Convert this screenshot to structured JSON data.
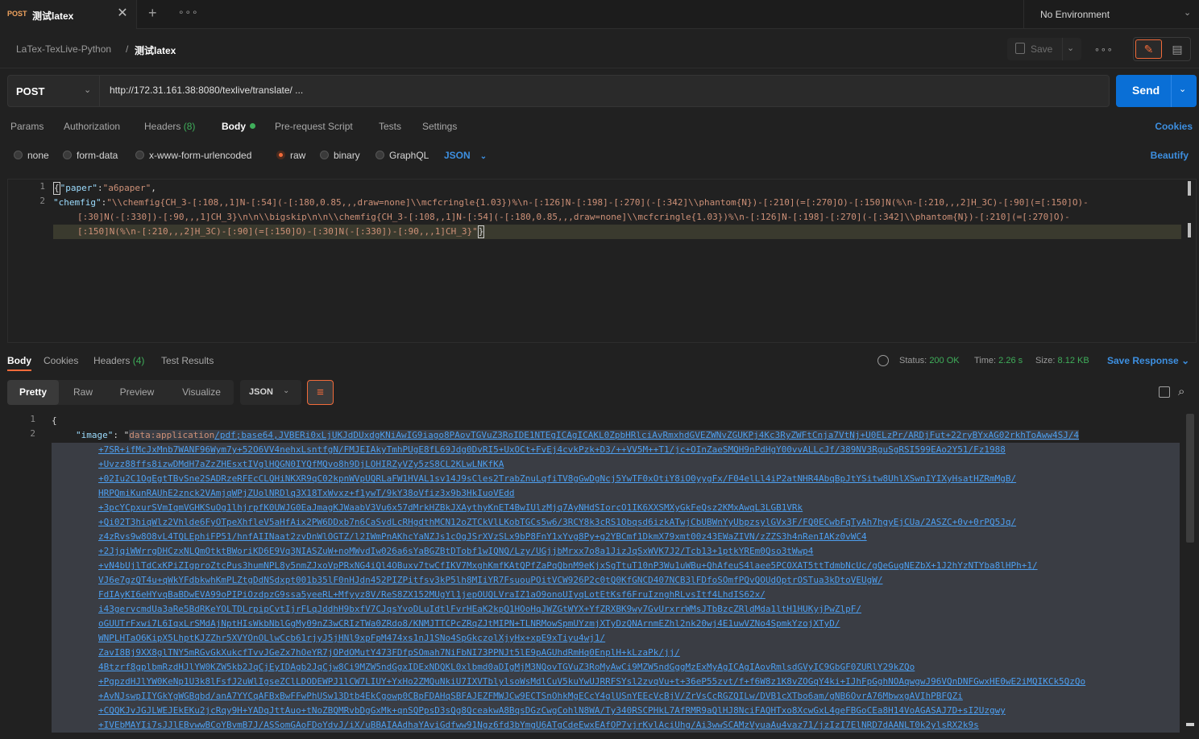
{
  "tab": {
    "method": "POST",
    "name": "测试latex",
    "close": "✕"
  },
  "tabbar": {
    "new_tab": "+",
    "more": "∘∘∘"
  },
  "environment": {
    "label": "No Environment",
    "chevron": "⌄"
  },
  "breadcrumb": {
    "collection": "LaTex-TexLive-Python",
    "separator": "/",
    "request": "测试latex"
  },
  "toolbar": {
    "save_label": "Save",
    "more": "∘∘∘"
  },
  "request": {
    "method": "POST",
    "url": "http://172.31.161.38:8080/texlive/translate/ ...",
    "send_label": "Send"
  },
  "request_tabs": {
    "params": "Params",
    "authorization": "Authorization",
    "headers": "Headers",
    "headers_count": "(8)",
    "body": "Body",
    "pre_request": "Pre-request Script",
    "tests": "Tests",
    "settings": "Settings",
    "cookies": "Cookies"
  },
  "body_types": {
    "none": "none",
    "form_data": "form-data",
    "urlencoded": "x-www-form-urlencoded",
    "raw": "raw",
    "binary": "binary",
    "graphql": "GraphQL",
    "format": "JSON",
    "beautify": "Beautify",
    "selected": "raw"
  },
  "editor": {
    "line_numbers": [
      "1",
      "2"
    ],
    "line1_key": "\"paper\"",
    "line1_value": "\"a6paper\"",
    "line2_key": "\"chemfig\"",
    "line2_part1": "\"\\\\chemfig{CH_3-[:108,,1]N-[:54](-[:180,0.85,,,draw=none]\\\\mcfcringle{1.03})%\\n-[:126]N-[:198]-[:270](-[:342]\\\\phantom{N})-[:210](=[:270]O)-[:150]N(%\\n-[:210,,,2]H_3C)-[:90](=[:150]O)-",
    "line2_part2": "[:30]N(-[:330])-[:90,,,1]CH_3}\\n\\n\\\\bigskip\\n\\n\\\\chemfig{CH_3-[:108,,1]N-[:54](-[:180,0.85,,,draw=none]\\\\mcfcringle{1.03})%\\n-[:126]N-[:198]-[:270](-[:342]\\\\phantom{N})-[:210](=[:270]O)-",
    "line2_part3": "[:150]N(%\\n-[:210,,,2]H_3C)-[:90](=[:150]O)-[:30]N(-[:330])-[:90,,,1]CH_3}\""
  },
  "response_tabs": {
    "body": "Body",
    "cookies": "Cookies",
    "headers": "Headers",
    "headers_count": "(4)",
    "test_results": "Test Results"
  },
  "response_status": {
    "status_label": "Status:",
    "status_value": "200 OK",
    "time_label": "Time:",
    "time_value": "2.26 s",
    "size_label": "Size:",
    "size_value": "8.12 KB",
    "save_response": "Save Response"
  },
  "response_view": {
    "pretty": "Pretty",
    "raw": "Raw",
    "preview": "Preview",
    "visualize": "Visualize",
    "format": "JSON"
  },
  "response_body": {
    "line_numbers": [
      "1",
      "2"
    ],
    "open_brace": "{",
    "key": "\"image\"",
    "colon": ": \"",
    "data_prefix": "data:application",
    "lines": [
      "/pdf;base64,JVBERi0xLjUKJdDUxdgKNiAwIG9iago8PAovTGVuZ3RoIDE1NTEgICAgICAKL0ZpbHRlciAvRmxhdGVEZWNvZGUKPj4Kc3RyZWFtCnja7VtNj+U0ELzPr/ARDjFut+22ryBYxAG02rkhToAww4SJ/4",
      "+7SR+ifMcJxMnb7WANF96Wym7y+52O6VV4nehxLsntfgN/FMJEIAkyTmhPUgE8fL69Jdg0DvRI5+UxOCt+FvEj4cvkPzk+D3/++VV5M++T1/jc+OInZaeSMQH9nPdHgY00vvALLcJf/389NV3RguSgRSI599EAo2Y51/Fz1988",
      "+Uvzz88ffs8izwDMdH7aZzZHEsxtIVglHQGN0IYQfMQvo8h9DjLOHIRZyVZy5zS8CL2KLwLNKfKA",
      "+02Iu2C1OgEgtTBvSne2SADRzeRFEcCLQHiNKXR9qC02kpnWVpUQRLaFW1HVAL1sv14J9sCles2TrabZnuLqfiTV8gGwDgNcj5YwTF0xOtiY8iO0yygFx/F04elLl4iP2atNHR4AbqBpJtYSitw8UhlXSwnIYIXyHsatHZRmMgB/",
      "HRPQmiKunRAUhE2znck2VAmjqWPjZUolNRDlq3X18TxWvxz+f1ywT/9kY38oVfiz3x9b3HkIuoVEdd",
      "+3pcYCpxurSVmIqmVGHKSuOg1lhjrpfK0UWJG0EaJmagKJWaabV3Vu6x57dMrkHZBkJXAythyKnET4BwIUlzMjq7AyNHdSIorcO1IK6XXSMXyGkFeQsz2KMxAwqL3LGB1VRk",
      "+Qi02T3hiqWlz2Vhlde6FyOTpeXhfleV5aHfAix2PW6DDxb7n6CaSvdLcRHgdthMCN12oZTCkVlLKobTGCs5w6/3RCY8k3cRS1Obqsd6izkATwjCbUBWnYyUbpzsylGVx3F/FQ0ECwbFqTyAh7hgyEjCUa/2ASZC+0v+0rPQ5Jq/",
      "z4zRvs9w8O8vL4TQLEphiFP51/hnfAIINaat2zvDnWlOGTZ/l2IWmPnAKhcYaNZJs1cOgJSrXVzSLx9bP8FnY1xYvg8Py+g2YBCmf1DkmX79xmt00z43EWaZIVN/zZZS3h4nRenIAKz0vWC4",
      "+2JjqiWWrrgDHCzxNLQmOtktBWoriKD6E9Vq3NIASZuW+noMWvdIw026a6sYaBGZBtDTobf1wIQNQ/Lzy/UGjjbMrxx7o8a1JizJqSxWVK7J2/Tcb13+1ptkYREm0Qso3tWwp4",
      "+vN4bUjlTdCxKPiZIgproZtcPus3humNPL8y5nmZJxoVpPRxNG4iQl4OBuxv7twCfIKV7MxghKmfKAtQPfZaPqQbnM9eKjxSgTtuT10nP3Wu1uWBu+QhAfeuS4laee5PCOXAT5ttTdmbNcUc/gQeGugNEZbX+1J2hYzNTYba8lHPh+1/",
      "VJ6e7gzQT4u+qWkYFdbkwhKmPLZtgDdNSdxpt001b35lF0nHJdn452PIZPitfsv3kP5lh8MIiYR7FsuouPOitVCW926P2c0tQ0KfGNCD407NCB3lFDfoSOmfPQvQOUdOptrOSTua3kDtoVEUgW/",
      "FdIAyKI6eHYvqBaBDwEVA99oPIPiOzdpzG9ssa5yeeRL+Mfyyz8V/ReS8ZX152MUgYl1jepOUQLVraIZ1aO9onoUIyqLotEtKsf6FruIznghRLvsItf4LhdIS62x/",
      "i43gervcmdUa3aRe5BdRKeYOLTDLrpipCvtIjrFLqJddhH9bxfV7CJqsYvoDLuIdtlFvrHEaK2kpQ1HOoHqJWZGtWYX+YfZRXBK9wy7GvUrxrrWMsJTbBzcZRldMda1ltH1HUKyjPwZlpF/",
      "oGUUTrFxwi7L6IqxLrSMdAjNptHIsWkbNblGgMy09nZ3wCRIzTWa0ZRdo8/KNMJTTCPcZRqZJtMIPN+TLNRMowSpmUYzmjXTyDzQNArnmEZhl2nk20wj4E1uwVZNo4SpmkYzojXTyD/",
      "WNPLHTaO6KipX5LhptKJZZhr5XVYOnOLlwCcb61rjyJ5jHNl9xpFpM474xs1nJ1SNo4SpGkczolXjyHx+xpE9xTiyu4wj1/",
      "ZavI8Bj9XX8glTNY5mRGvGkXukcfTvvJGeZx7hOeYR7jOPdOMutY473FDfpSOmah7NiFbNI73PPNJt5lE9pAGUhdRmHq0EnplH+kLzaPk/jj/",
      "4Btzrf8gplbmRzdHJlYW0KZW5kb2JqCjEyIDAgb2JqCjw8Ci9MZW5ndGgxIDExNDQKL0xlbmd0aDIgMjM3NQovTGVuZ3RoMyAwCi9MZW5ndGggMzExMyAgICAgIAovRmlsdGVyIC9GbGF0ZURlY29kZQo",
      "+PgpzdHJlYW0KeNp1U3k8lFsfJ2uWlIgseZClLDODEWPJ1lCW7LIUY+YxHo2ZMQuNkiU7IXVTblylsoWsMdlCuV5kuYwUJRRFSYsl2zvqVu+t+36eP55zvt/f+f6W8z1K8vZOGqY4ki+IJhFpGghNOAqwgwJ96VQnDNFGwxHE0wE2iMQIKCk5QzQo",
      "+AvNJswpIIYGkYgWGBqbd/anA7YYCqAFBxBwFFwPhUSw13Dtb4EkCgowp0CBpFDAHqSBFAJEZFMWJCw9ECTSnOhkMgECcY4glUSnYEEcVcBjV/ZrVsCcRGZQILw/DVB1cXTbo6am/gNB6OvrA76MbwxgAVIhPBFQZi",
      "+CQQKJvJGJLWEJEkEKu2jcRqy9H+YADqJttAuo+tNoZBQMRvbDgGxMk+qnSQPpsD3sQg8QceakwA8BqsDGzCwgCohlN8WA/Ty340RSCPHkL7AfRMR9aQlHJ8NciFAQHTxo8XcwGxL4geFBGoCEa8H14VoAGASAJ7D+sI2Uzgwy",
      "+IVEbMAYIi7sJJlEBvwwBCoYBvmB7J/ASSomGAoFDoYdvJ/iX/uBBAIAAdhaYAviGdfww91Ngz6fd3bYmgU6ATgCdeEwxEAfOP7vjrKvlAciUhg/Ai3wwSCAMzVyuaAu4vaz71/jzIzI7ElNRD7dAANLT0k2ylsRX2k9s"
    ]
  }
}
